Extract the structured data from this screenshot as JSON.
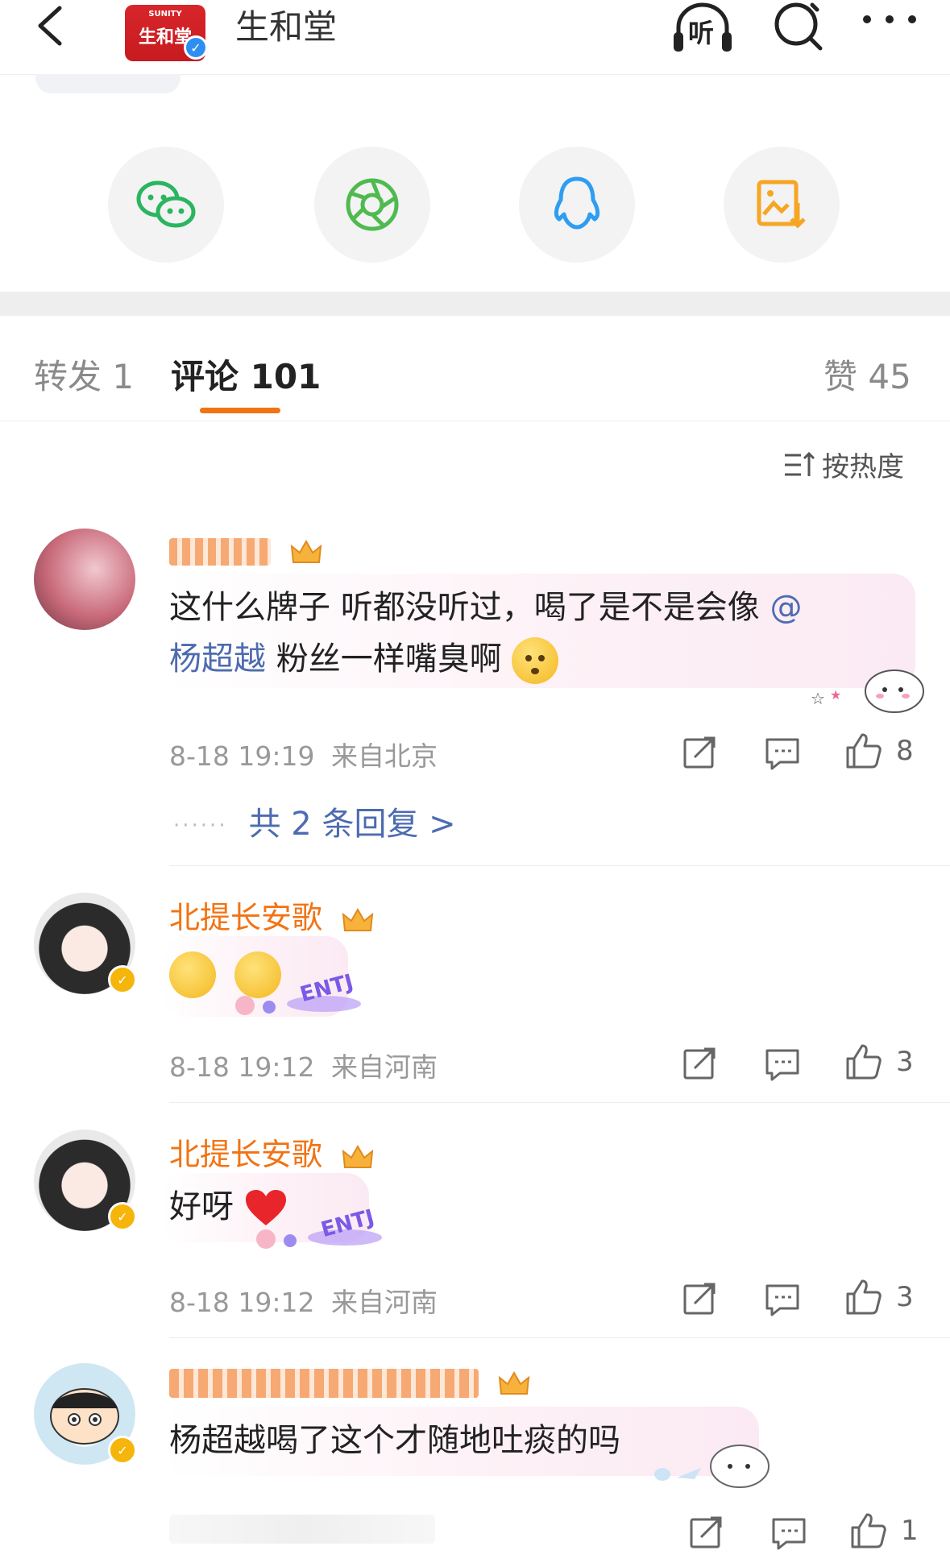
{
  "header": {
    "title": "生和堂",
    "logo_brand": "SUNITY",
    "logo_cn": "生和堂",
    "listen_label": "听"
  },
  "share": {
    "items": [
      {
        "icon": "wechat-icon"
      },
      {
        "icon": "moments-icon"
      },
      {
        "icon": "qq-icon"
      },
      {
        "icon": "save-image-icon"
      }
    ]
  },
  "tabs": {
    "repost": "转发 1",
    "comments": "评论 101",
    "likes": "赞 45"
  },
  "sort": {
    "label": "按热度"
  },
  "comments": [
    {
      "username": "",
      "text_before": "这什么牌子 听都没听过，喝了是不是会像",
      "mention_at": "@",
      "mention_name": "杨超越",
      "text_after": "粉丝一样嘴臭啊",
      "time": "8-18 19:19",
      "location": "来自北京",
      "likes": "8",
      "replies_label": "共 2 条回复 >"
    },
    {
      "username": "北提长安歌",
      "time": "8-18 19:12",
      "location": "来自河南",
      "likes": "3",
      "sticker_text": "ENTJ"
    },
    {
      "username": "北提长安歌",
      "text": "好呀",
      "time": "8-18 19:12",
      "location": "来自河南",
      "likes": "3",
      "sticker_text": "ENTJ"
    },
    {
      "username": "",
      "text": "杨超越喝了这个才随地吐痰的吗",
      "likes": "1"
    }
  ],
  "colors": {
    "accent": "#f27314",
    "mention": "#4d6bb0",
    "verified_blue": "#2e8ff0",
    "verified_yellow": "#f5b50a"
  }
}
